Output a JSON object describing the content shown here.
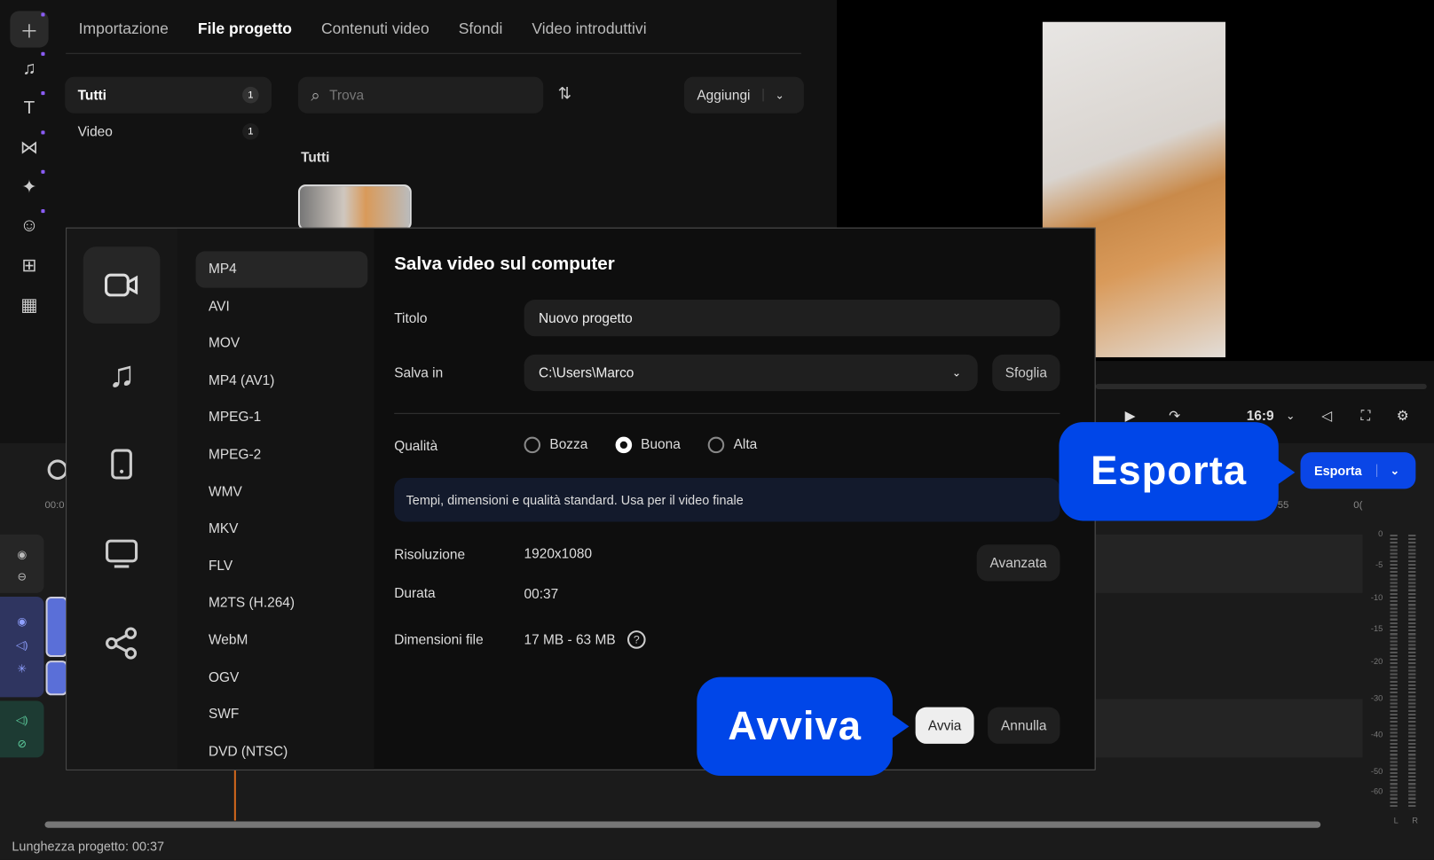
{
  "rail_icons": [
    "plus-icon",
    "music-icon",
    "text-icon",
    "transitions-icon",
    "effects-icon",
    "sticker-icon",
    "toolbox-icon",
    "apps-icon"
  ],
  "tabs": [
    "Importazione",
    "File progetto",
    "Contenuti video",
    "Sfondi",
    "Video introduttivi"
  ],
  "categories": [
    {
      "label": "Tutti",
      "count": "1"
    },
    {
      "label": "Video",
      "count": "1"
    }
  ],
  "search": {
    "placeholder": "Trova"
  },
  "add_button": "Aggiungi",
  "section_title": "Tutti",
  "player": {
    "aspect": "16:9"
  },
  "export_button": "Esporta",
  "timeline": {
    "ruler_left": "00:0",
    "ruler_right_a": "55",
    "ruler_right_b": "0(",
    "meter_labels": [
      "0",
      "-5",
      "-10",
      "-15",
      "-20",
      "-30",
      "-40",
      "-50",
      "-60"
    ],
    "channels": [
      "L",
      "R"
    ]
  },
  "status": "Lunghezza progetto: 00:37",
  "dialog": {
    "title": "Salva video sul computer",
    "formats": [
      "MP4",
      "AVI",
      "MOV",
      "MP4 (AV1)",
      "MPEG-1",
      "MPEG-2",
      "WMV",
      "MKV",
      "FLV",
      "M2TS (H.264)",
      "WebM",
      "OGV",
      "SWF",
      "DVD (NTSC)"
    ],
    "title_label": "Titolo",
    "title_value": "Nuovo progetto",
    "save_label": "Salva in",
    "save_value": "C:\\Users\\Marco",
    "browse": "Sfoglia",
    "quality_label": "Qualità",
    "quality_options": [
      "Bozza",
      "Buona",
      "Alta"
    ],
    "quality_selected": "Buona",
    "quality_hint": "Tempi, dimensioni e qualità standard. Usa per il video finale",
    "resolution_label": "Risoluzione",
    "resolution_value": "1920x1080",
    "duration_label": "Durata",
    "duration_value": "00:37",
    "size_label": "Dimensioni file",
    "size_value": "17 MB - 63 MB",
    "advanced": "Avanzata",
    "start": "Avvia",
    "cancel": "Annulla"
  },
  "callouts": {
    "export": "Esporta",
    "start": "Avviva"
  }
}
